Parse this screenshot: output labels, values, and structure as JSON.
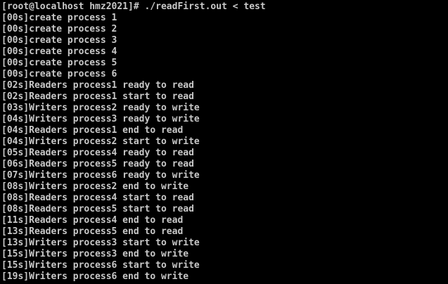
{
  "terminal": {
    "text_color": "#c8c8c8",
    "background_color": "#000000",
    "lines": [
      "[root@localhost hmz2021]# ./readFirst.out < test",
      "[00s]create process 1",
      "[00s]create process 2",
      "[00s]create process 3",
      "[00s]create process 4",
      "[00s]create process 5",
      "[00s]create process 6",
      "[02s]Readers process1 ready to read",
      "[02s]Readers process1 start to read",
      "[03s]Writers process2 ready to write",
      "[04s]Writers process3 ready to write",
      "[04s]Readers process1 end to read",
      "[04s]Writers process2 start to write",
      "[05s]Readers process4 ready to read",
      "[06s]Readers process5 ready to read",
      "[07s]Writers process6 ready to write",
      "[08s]Writers process2 end to write",
      "[08s]Readers process4 start to read",
      "[08s]Readers process5 start to read",
      "[11s]Readers process4 end to read",
      "[13s]Readers process5 end to read",
      "[13s]Writers process3 start to write",
      "[15s]Writers process3 end to write",
      "[15s]Writers process6 start to write",
      "[19s]Writers process6 end to write"
    ]
  }
}
